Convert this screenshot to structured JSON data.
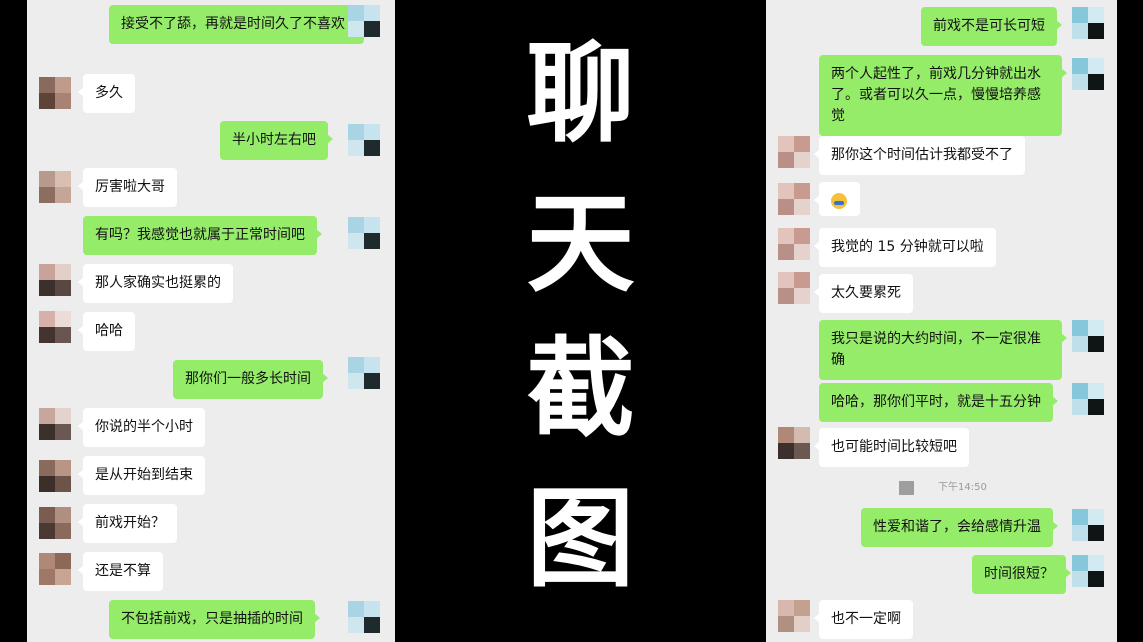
{
  "center": {
    "title_chars": [
      "聊",
      "天",
      "截",
      "图"
    ]
  },
  "left_chat": {
    "messages": [
      {
        "side": "out",
        "text": "接受不了舔，再就是时间久了不喜欢"
      },
      {
        "side": "in",
        "text": "多久"
      },
      {
        "side": "out",
        "text": "半小时左右吧"
      },
      {
        "side": "in",
        "text": "厉害啦大哥"
      },
      {
        "side": "out",
        "text": "有吗？我感觉也就属于正常时间吧"
      },
      {
        "side": "in",
        "text": "那人家确实也挺累的"
      },
      {
        "side": "in",
        "text": "哈哈"
      },
      {
        "side": "out",
        "text": "那你们一般多长时间"
      },
      {
        "side": "in",
        "text": "你说的半个小时"
      },
      {
        "side": "in",
        "text": "是从开始到结束"
      },
      {
        "side": "in",
        "text": "前戏开始？"
      },
      {
        "side": "in",
        "text": "还是不算"
      },
      {
        "side": "out",
        "text": "不包括前戏，只是抽插的时间"
      }
    ]
  },
  "right_chat": {
    "timestamp": "下午14:50",
    "messages": [
      {
        "side": "out",
        "text": "前戏不是可长可短"
      },
      {
        "side": "out",
        "text": "两个人起性了，前戏几分钟就出水了。或者可以久一点，慢慢培养感觉"
      },
      {
        "side": "in",
        "text": "那你这个时间估计我都受不了"
      },
      {
        "side": "in",
        "text": "",
        "emoji": "crying-laughing-emoji"
      },
      {
        "side": "in",
        "text": "我觉的 15 分钟就可以啦"
      },
      {
        "side": "in",
        "text": "太久要累死"
      },
      {
        "side": "out",
        "text": "我只是说的大约时间，不一定很准确"
      },
      {
        "side": "out",
        "text": "哈哈，那你们平时，就是十五分钟"
      },
      {
        "side": "in",
        "text": "也可能时间比较短吧"
      },
      {
        "side": "out",
        "text": "性爱和谐了，会给感情升温"
      },
      {
        "side": "out",
        "text": "时间很短？"
      },
      {
        "side": "in",
        "text": "也不一定啊"
      }
    ]
  },
  "colors": {
    "outgoing_bubble": "#95ec69",
    "incoming_bubble": "#ffffff",
    "chat_background": "#ededed",
    "center_background": "#000000",
    "title_text": "#ffffff"
  }
}
